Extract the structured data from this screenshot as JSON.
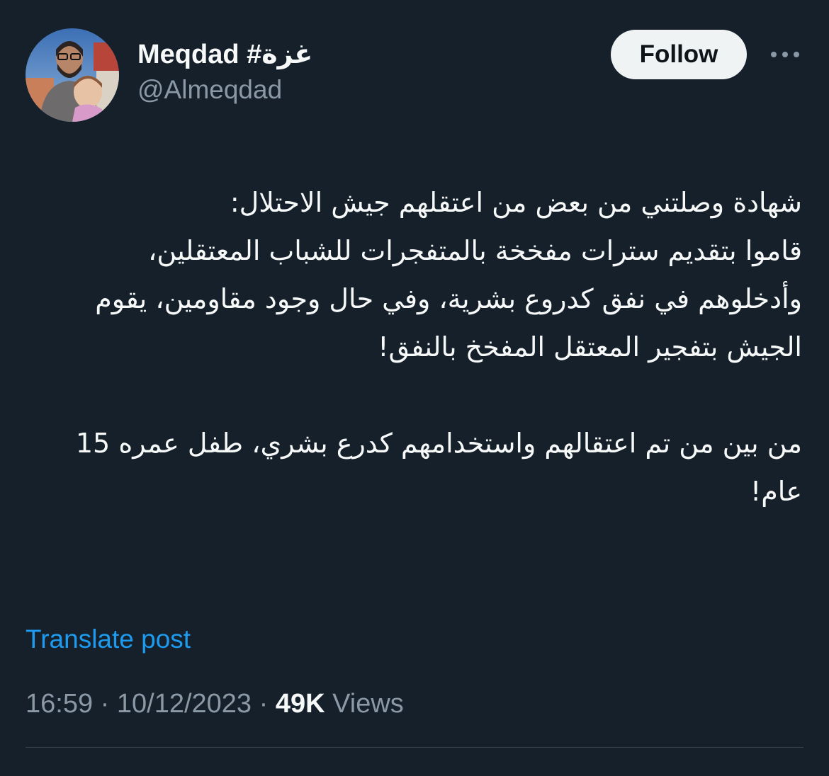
{
  "author": {
    "display_name": "Meqdad #غزة",
    "handle": "@Almeqdad",
    "avatar_icon": "profile-photo-man-with-child"
  },
  "header": {
    "follow_label": "Follow",
    "more_icon": "ellipsis-icon"
  },
  "tweet": {
    "paragraphs": [
      "شهادة وصلتني من بعض من اعتقلهم جيش الاحتلال:\nقاموا بتقديم سترات مفخخة بالمتفجرات للشباب المعتقلين، وأدخلوهم في نفق كدروع بشرية، وفي حال وجود مقاومين، يقوم الجيش بتفجير المعتقل المفخخ بالنفق!",
      "من بين من تم اعتقالهم واستخدامهم كدرع بشري، طفل عمره 15 عام!"
    ],
    "translate_label": "Translate post"
  },
  "meta": {
    "time": "16:59",
    "separator": " · ",
    "date": "10/12/2023",
    "views_count": "49K",
    "views_label": "Views"
  },
  "colors": {
    "background": "#15202b",
    "text_primary": "#f7f9f9",
    "text_secondary": "#8b98a5",
    "link": "#1d9bf0",
    "follow_button_bg": "#eff3f4",
    "divider": "#38444d"
  }
}
